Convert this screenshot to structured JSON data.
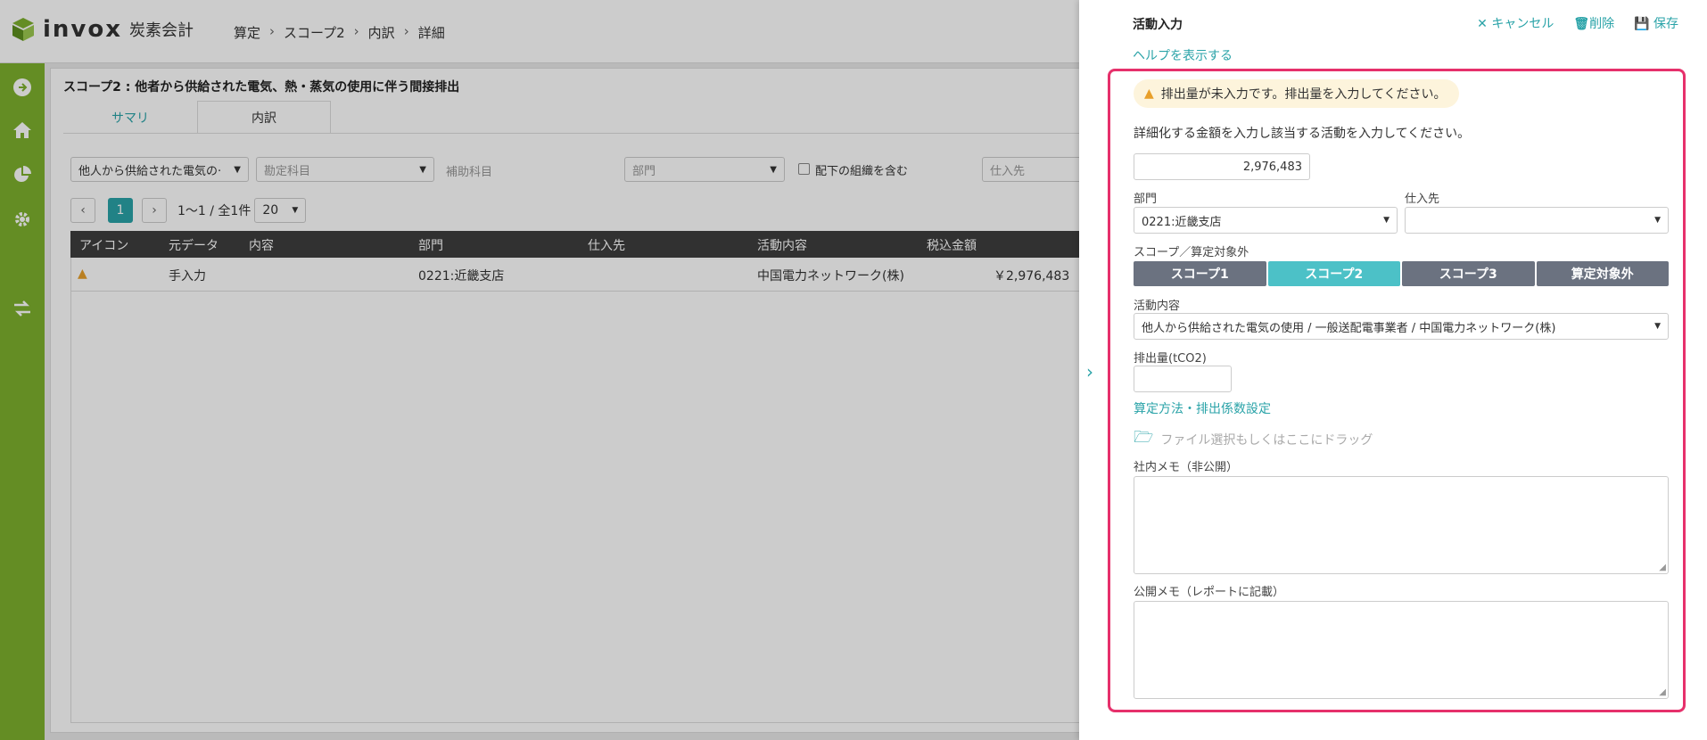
{
  "header": {
    "logo_text": "invox",
    "logo_sub": "炭素会計",
    "breadcrumb": [
      "算定",
      "スコープ2",
      "内訳",
      "詳細"
    ]
  },
  "sidebar": {
    "icons": [
      "arrow-right-circle-icon",
      "home-icon",
      "pie-chart-icon",
      "gear-icon",
      "transfer-icon"
    ]
  },
  "main": {
    "title": "スコープ2 : 他者から供給された電気、熱・蒸気の使用に伴う間接排出",
    "tabs": [
      {
        "label": "サマリ"
      },
      {
        "label": "内訳"
      }
    ],
    "filters": {
      "activity": "他人から供給された電気の·",
      "account": "勘定科目",
      "sub_account": "補助科目",
      "department": "部門",
      "include_sub": "配下の組織を含む",
      "supplier": "仕入先"
    },
    "pager": {
      "current": "1",
      "range": "1〜1 / 全1件",
      "per_page": "20"
    },
    "table": {
      "headers": [
        "アイコン",
        "元データ",
        "内容",
        "部門",
        "仕入先",
        "活動内容",
        "税込金額"
      ],
      "rows": [
        {
          "source": "手入力",
          "content": "",
          "department": "0221:近畿支店",
          "supplier": "",
          "activity": "中国電力ネットワーク(株)",
          "amount": "￥2,976,483"
        }
      ]
    }
  },
  "drawer": {
    "title": "活動入力",
    "cancel": "キャンセル",
    "delete": "削除",
    "save": "保存",
    "help": "ヘルプを表示する",
    "warning": "排出量が未入力です。排出量を入力してください。",
    "instruction": "詳細化する金額を入力し該当する活動を入力してください。",
    "amount": "2,976,483",
    "department_label": "部門",
    "department_value": "0221:近畿支店",
    "supplier_label": "仕入先",
    "supplier_value": "",
    "scope_label": "スコープ／算定対象外",
    "scopes": [
      "スコープ1",
      "スコープ2",
      "スコープ3",
      "算定対象外"
    ],
    "active_scope": "スコープ2",
    "activity_label": "活動内容",
    "activity_value": "他人から供給された電気の使用 / 一般送配電事業者 / 中国電力ネットワーク(株)",
    "emission_label": "排出量(tCO2)",
    "emission_value": "",
    "method_link": "算定方法・排出係数設定",
    "file_drop": "ファイル選択もしくはここにドラッグ",
    "internal_memo_label": "社内メモ（非公開）",
    "public_memo_label": "公開メモ（レポートに記載）"
  },
  "colors": {
    "brand_green": "#7db12e",
    "accent_teal": "#2aa3a8",
    "highlight": "#e6306b",
    "scope_active": "#4cc1c7",
    "scope_inactive": "#6b7280"
  }
}
